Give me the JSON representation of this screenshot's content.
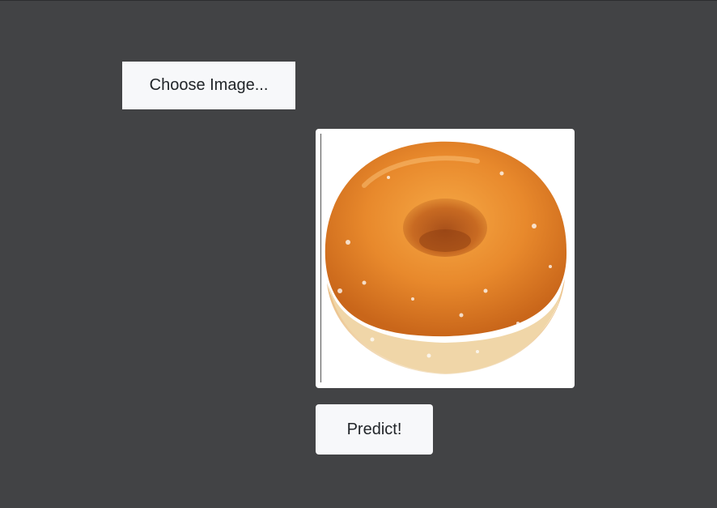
{
  "upload": {
    "choose_label": "Choose Image..."
  },
  "preview": {
    "image_subject": "glazed-donut-image",
    "colors": {
      "background": "#424345",
      "card": "#ffffff",
      "button": "#f7f8fa",
      "donut_glaze": "#e8892c",
      "donut_dough": "#f1dcb6"
    }
  },
  "actions": {
    "predict_label": "Predict!"
  }
}
